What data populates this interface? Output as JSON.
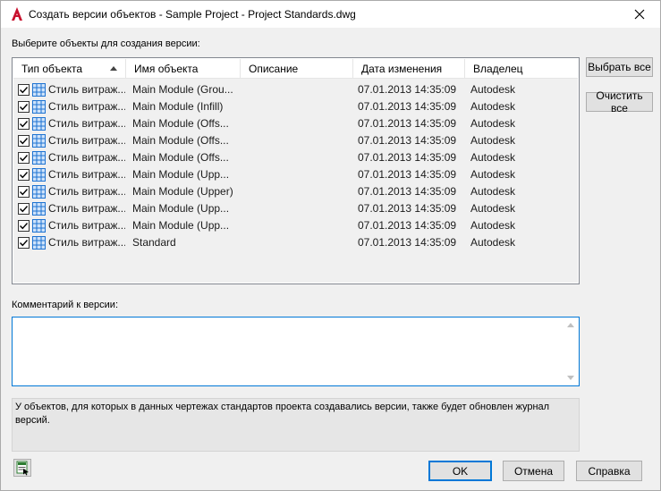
{
  "window": {
    "title": "Создать версии объектов - Sample Project - Project Standards.dwg",
    "close_glyph": "✕"
  },
  "objects_label": "Выберите объекты для создания версии:",
  "columns": [
    "Тип объекта",
    "Имя объекта",
    "Описание",
    "Дата изменения",
    "Владелец"
  ],
  "rows": [
    {
      "checked": true,
      "type": "Стиль витраж...",
      "name": "Main Module (Grou...",
      "description": "",
      "date": "07.01.2013 14:35:09",
      "owner": "Autodesk"
    },
    {
      "checked": true,
      "type": "Стиль витраж...",
      "name": "Main Module (Infill)",
      "description": "",
      "date": "07.01.2013 14:35:09",
      "owner": "Autodesk"
    },
    {
      "checked": true,
      "type": "Стиль витраж...",
      "name": "Main Module (Offs...",
      "description": "",
      "date": "07.01.2013 14:35:09",
      "owner": "Autodesk"
    },
    {
      "checked": true,
      "type": "Стиль витраж...",
      "name": "Main Module (Offs...",
      "description": "",
      "date": "07.01.2013 14:35:09",
      "owner": "Autodesk"
    },
    {
      "checked": true,
      "type": "Стиль витраж...",
      "name": "Main Module (Offs...",
      "description": "",
      "date": "07.01.2013 14:35:09",
      "owner": "Autodesk"
    },
    {
      "checked": true,
      "type": "Стиль витраж...",
      "name": "Main Module (Upp...",
      "description": "",
      "date": "07.01.2013 14:35:09",
      "owner": "Autodesk"
    },
    {
      "checked": true,
      "type": "Стиль витраж...",
      "name": "Main Module (Upper)",
      "description": "",
      "date": "07.01.2013 14:35:09",
      "owner": "Autodesk"
    },
    {
      "checked": true,
      "type": "Стиль витраж...",
      "name": "Main Module (Upp...",
      "description": "",
      "date": "07.01.2013 14:35:09",
      "owner": "Autodesk"
    },
    {
      "checked": true,
      "type": "Стиль витраж...",
      "name": "Main Module (Upp...",
      "description": "",
      "date": "07.01.2013 14:35:09",
      "owner": "Autodesk"
    },
    {
      "checked": true,
      "type": "Стиль витраж...",
      "name": "Standard",
      "description": "",
      "date": "07.01.2013 14:35:09",
      "owner": "Autodesk"
    }
  ],
  "buttons": {
    "select_all": "Выбрать все",
    "clear_all": "Очистить все",
    "ok": "OK",
    "cancel": "Отмена",
    "help": "Справка"
  },
  "comment_label": "Комментарий к версии:",
  "comment_value": "",
  "info_text": "У объектов, для которых в данных чертежах стандартов проекта создавались версии, также будет обновлен журнал версий.",
  "colors": {
    "accent": "#0078d7",
    "app_icon_red": "#c8102e",
    "grid_icon": "#1e73d2"
  }
}
